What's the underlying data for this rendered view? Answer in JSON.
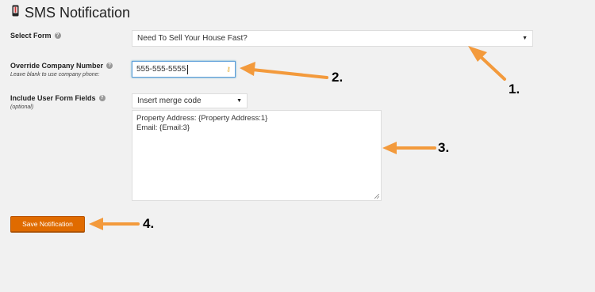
{
  "page": {
    "title": "SMS Notification",
    "title_icon": "phone-icon"
  },
  "select_form": {
    "label": "Select Form",
    "value": "Need To Sell Your House Fast?"
  },
  "override_number": {
    "label": "Override Company Number",
    "sublabel": "Leave blank to use company phone:",
    "value": "555-555-5555"
  },
  "user_fields": {
    "label": "Include User Form Fields",
    "sublabel": "(optional)",
    "merge_select": "Insert merge code",
    "textarea_lines": [
      "Property Address: {Property Address:1}",
      "Email: {Email:3}"
    ]
  },
  "save_button": {
    "label": "Save Notification",
    "color": "#e06b00"
  },
  "callouts": [
    "1.",
    "2.",
    "3.",
    "4."
  ],
  "colors": {
    "background": "#f1f1f1",
    "arrow": "#f39a3c",
    "focus_border": "#5b9dd9"
  }
}
